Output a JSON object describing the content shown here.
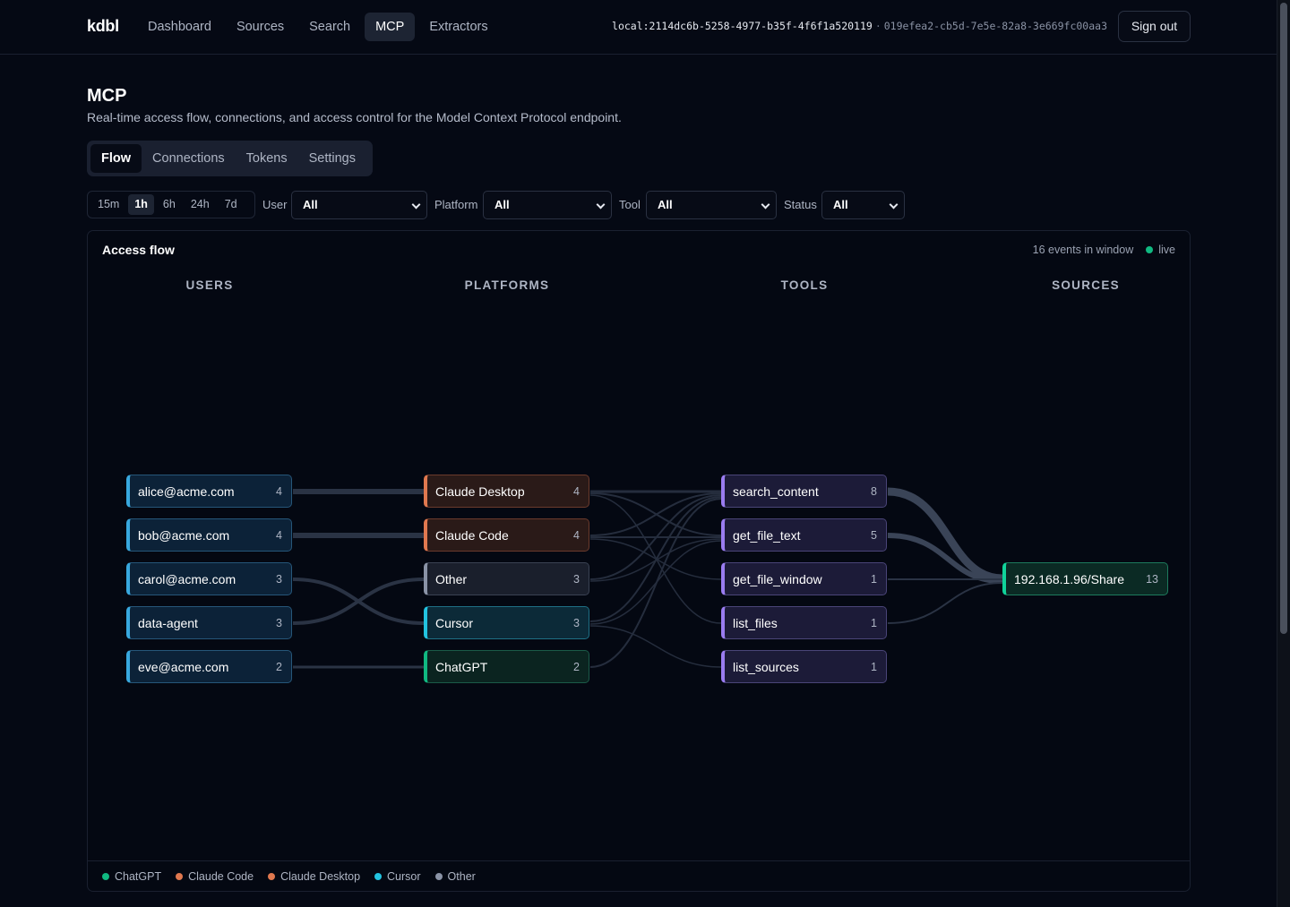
{
  "app": {
    "brand": "kdbl",
    "nav": [
      "Dashboard",
      "Sources",
      "Search",
      "MCP",
      "Extractors"
    ],
    "active_nav": "MCP",
    "session_id": "local:2114dc6b-5258-4977-b35f-4f6f1a520119",
    "session_sep": "·",
    "session_id2": "019efea2-cb5d-7e5e-82a8-3e669fc00aa3",
    "sign_out": "Sign out"
  },
  "page": {
    "title": "MCP",
    "subtitle": "Real-time access flow, connections, and access control for the Model Context Protocol endpoint.",
    "tabs": [
      "Flow",
      "Connections",
      "Tokens",
      "Settings"
    ],
    "active_tab": "Flow"
  },
  "filters": {
    "time_ranges": [
      "15m",
      "1h",
      "6h",
      "24h",
      "7d"
    ],
    "active_time": "1h",
    "user_label": "User",
    "user_value": "All",
    "platform_label": "Platform",
    "platform_value": "All",
    "tool_label": "Tool",
    "tool_value": "All",
    "status_label": "Status",
    "status_value": "All"
  },
  "flow": {
    "title": "Access flow",
    "events": "16 events in window",
    "live": "live",
    "columns": [
      "USERS",
      "PLATFORMS",
      "TOOLS",
      "SOURCES"
    ],
    "users": [
      {
        "label": "alice@acme.com",
        "count": "4"
      },
      {
        "label": "bob@acme.com",
        "count": "4"
      },
      {
        "label": "carol@acme.com",
        "count": "3"
      },
      {
        "label": "data-agent",
        "count": "3"
      },
      {
        "label": "eve@acme.com",
        "count": "2"
      }
    ],
    "platforms": [
      {
        "label": "Claude Desktop",
        "count": "4"
      },
      {
        "label": "Claude Code",
        "count": "4"
      },
      {
        "label": "Other",
        "count": "3"
      },
      {
        "label": "Cursor",
        "count": "3"
      },
      {
        "label": "ChatGPT",
        "count": "2"
      }
    ],
    "tools": [
      {
        "label": "search_content",
        "count": "8"
      },
      {
        "label": "get_file_text",
        "count": "5"
      },
      {
        "label": "get_file_window",
        "count": "1"
      },
      {
        "label": "list_files",
        "count": "1"
      },
      {
        "label": "list_sources",
        "count": "1"
      }
    ],
    "sources": [
      {
        "label": "192.168.1.96/Share",
        "count": "13"
      }
    ],
    "legend": [
      {
        "label": "ChatGPT",
        "color": "#10b981"
      },
      {
        "label": "Claude Code",
        "color": "#e0784f"
      },
      {
        "label": "Claude Desktop",
        "color": "#e0784f"
      },
      {
        "label": "Cursor",
        "color": "#22c3e0"
      },
      {
        "label": "Other",
        "color": "#8a93a6"
      }
    ]
  }
}
